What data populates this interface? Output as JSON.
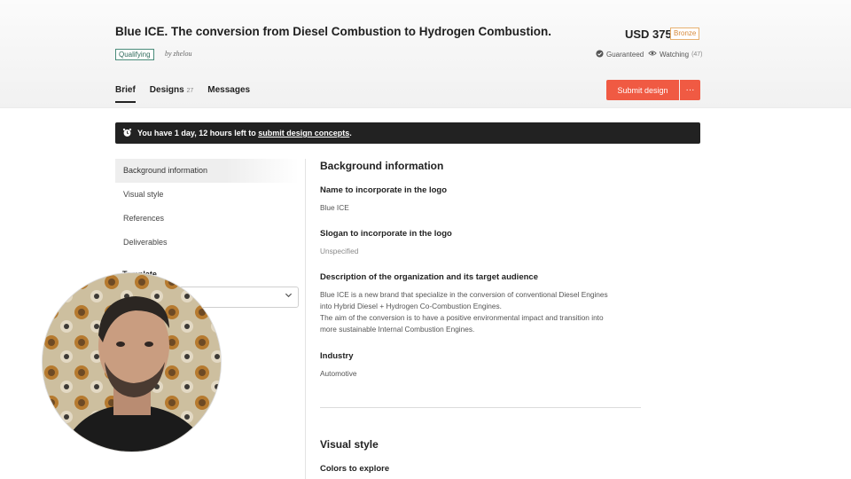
{
  "header": {
    "title": "Blue ICE. The conversion from Diesel Combustion to Hydrogen Combustion.",
    "status": "Qualifying",
    "by": "by zhelou",
    "price": "USD 375",
    "tier": "Bronze",
    "guaranteed": "Guaranteed",
    "watching_label": "Watching",
    "watching_count": "(47)"
  },
  "tabs": [
    {
      "label": "Brief",
      "count": ""
    },
    {
      "label": "Designs",
      "count": "27"
    },
    {
      "label": "Messages",
      "count": ""
    }
  ],
  "actions": {
    "submit": "Submit design",
    "more": "···"
  },
  "alert": {
    "prefix": "You have 1 day, 12 hours left to",
    "link": "submit design concepts",
    "suffix": "."
  },
  "sidebar": {
    "items": [
      {
        "label": "Background information"
      },
      {
        "label": "Visual style"
      },
      {
        "label": "References"
      },
      {
        "label": "Deliverables"
      }
    ],
    "template_label": "Template"
  },
  "content": {
    "section1": "Background information",
    "fields": [
      {
        "label": "Name to incorporate in the logo",
        "value": "Blue ICE"
      },
      {
        "label": "Slogan to incorporate in the logo",
        "value": "Unspecified"
      },
      {
        "label": "Description of the organization and its target audience",
        "value": [
          "Blue ICE is a new brand that specialize in the conversion of conventional Diesel Engines",
          "into Hybrid Diesel + Hydrogen Co-Combustion Engines.",
          "The aim of the conversion is to have a positive environmental impact and transition into",
          "more sustainable Internal Combustion Engines."
        ]
      },
      {
        "label": "Industry",
        "value": "Automotive"
      }
    ],
    "section2": "Visual style",
    "colors_label": "Colors to explore"
  },
  "colors": {
    "accent": "#f05a43",
    "alert_bg": "#222222",
    "tier": "#d68a3b",
    "status": "#2f6b5c"
  }
}
